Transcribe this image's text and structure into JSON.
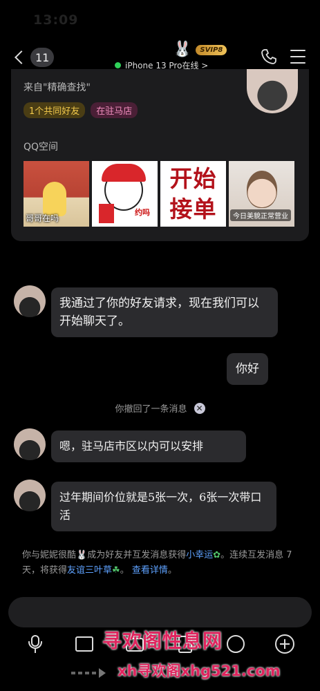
{
  "status_bar": {
    "time": "13:09"
  },
  "header": {
    "unread_count": "11",
    "vip_badge": "SVIP8",
    "device_status": "iPhone 13 Pro在线 >",
    "icons": [
      "back-chevron-icon",
      "bunny-icon",
      "phone-icon",
      "menu-icon"
    ]
  },
  "profile_card": {
    "source": "来自\"精确查找\"",
    "tags": [
      "1个共同好友",
      "在驻马店"
    ],
    "qzone_label": "QQ空间",
    "photo_captions": {
      "p1": "哥哥在吗",
      "p2": "约吗",
      "p3_line1": "开始",
      "p3_line2": "接单",
      "p4": "今日美貌正常营业"
    }
  },
  "messages": [
    {
      "from": "them",
      "text": "我通过了你的好友请求，现在我们可以开始聊天了。"
    },
    {
      "from": "me",
      "text": "你好"
    },
    {
      "from": "them",
      "text": "嗯，驻马店市区以内可以安排"
    },
    {
      "from": "them",
      "text": "过年期间价位就是5张一次，6张一次带口活"
    }
  ],
  "recall_notice": "你撤回了一条消息",
  "system_notice": {
    "part1": "你与妮妮很酷",
    "part2": "成为好友并互发消息获得",
    "link1": "小幸运",
    "part3": "。连续互发消息 7天，将获得",
    "link2": "友谊三叶草",
    "part4": "。",
    "link3": "查看详情",
    "part5": "。"
  },
  "watermark": {
    "line1": "寻欢阁性息网",
    "line2": "xh寻欢阁xhg521.com"
  },
  "colors": {
    "background": "#000000",
    "bubble": "#2b2b2e",
    "link": "#5ea2ff",
    "online": "#2fd159",
    "tag_mutual": "#f2c94c",
    "tag_location": "#ef8cbc",
    "watermark": "#e0245e"
  }
}
